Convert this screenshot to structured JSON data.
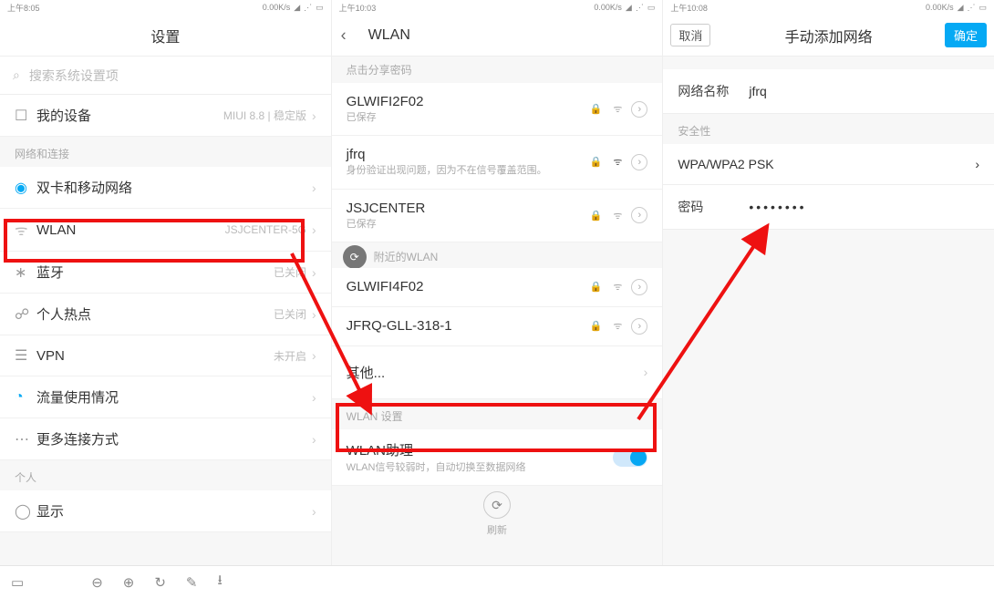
{
  "statusbar": {
    "time_a": "上午8:05",
    "time_b": "上午10:03",
    "time_c": "上午10:08",
    "net": "0.00K/s"
  },
  "screen1": {
    "title": "设置",
    "search_placeholder": "搜索系统设置项",
    "row_device": {
      "title": "我的设备",
      "right": "MIUI 8.8 | 稳定版"
    },
    "section_net": "网络和连接",
    "row_sim": {
      "title": "双卡和移动网络"
    },
    "row_wlan": {
      "title": "WLAN",
      "right": "JSJCENTER-5G"
    },
    "row_bt": {
      "title": "蓝牙",
      "right": "已关闭"
    },
    "row_hotspot": {
      "title": "个人热点",
      "right": "已关闭"
    },
    "row_vpn": {
      "title": "VPN",
      "right": "未开启"
    },
    "row_traffic": {
      "title": "流量使用情况"
    },
    "row_more": {
      "title": "更多连接方式"
    },
    "section_personal": "个人",
    "row_display": {
      "title": "显示"
    }
  },
  "screen2": {
    "title": "WLAN",
    "sub_share": "点击分享密码",
    "net1": {
      "title": "GLWIFI2F02",
      "sub": "已保存"
    },
    "net2": {
      "title": "jfrq",
      "sub": "身份验证出现问题，因为不在信号覆盖范围。"
    },
    "net3": {
      "title": "JSJCENTER",
      "sub": "已保存"
    },
    "nearby_label": "附近的WLAN",
    "net4": {
      "title": "GLWIFI4F02"
    },
    "net5": {
      "title": "JFRQ-GLL-318-1"
    },
    "row_other": {
      "title": "其他..."
    },
    "section_set": "WLAN 设置",
    "row_assist": {
      "title": "WLAN助理",
      "sub": "WLAN信号较弱时，自动切换至数据网络"
    },
    "refresh": "刷新"
  },
  "screen3": {
    "cancel": "取消",
    "title": "手动添加网络",
    "ok": "确定",
    "name_label": "网络名称",
    "name_value": "jfrq",
    "security_label": "安全性",
    "security_value": "WPA/WPA2 PSK",
    "password_label": "密码",
    "password_value": "••••••••"
  }
}
